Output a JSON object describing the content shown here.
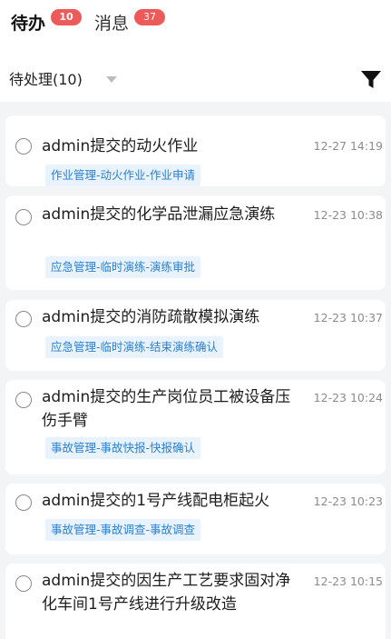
{
  "tabs": [
    {
      "label": "待办",
      "badge": "10"
    },
    {
      "label": "消息",
      "badge": "37"
    }
  ],
  "filter": {
    "label": "待处理(10)"
  },
  "icons": {
    "dropdown": "chevron-down-icon",
    "filter": "funnel-icon",
    "radio": "radio-unchecked-icon"
  },
  "colors": {
    "badge": "#ec5a5a",
    "tag_bg": "#e9f3fd",
    "tag_text": "#2b7fd1"
  },
  "tasks": [
    {
      "title": "admin提交的动火作业",
      "time": "12-27 14:19",
      "path": "作业管理-动火作业-作业申请"
    },
    {
      "title": "admin提交的化学品泄漏应急演练",
      "time": "12-23 10:38",
      "path": "应急管理-临时演练-演练审批"
    },
    {
      "title": "admin提交的消防疏散模拟演练",
      "time": "12-23 10:37",
      "path": "应急管理-临时演练-结束演练确认"
    },
    {
      "title": "admin提交的生产岗位员工被设备压伤手臂",
      "time": "12-23 10:24",
      "path": "事故管理-事故快报-快报确认"
    },
    {
      "title": "admin提交的1号产线配电柜起火",
      "time": "12-23 10:23",
      "path": "事故管理-事故调查-事故调查"
    },
    {
      "title": "admin提交的因生产工艺要求固对净化车间1号产线进行升级改造",
      "time": "12-23 10:15",
      "path": ""
    }
  ]
}
